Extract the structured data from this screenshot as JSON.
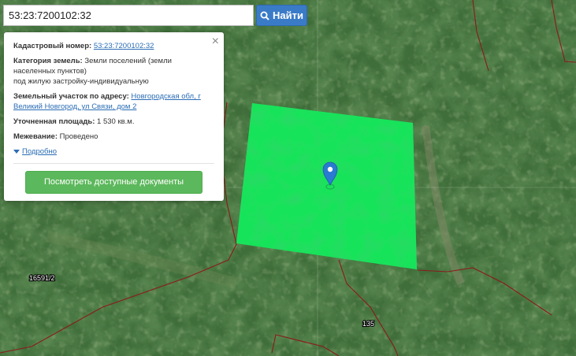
{
  "search": {
    "value": "53:23:7200102:32",
    "button_label": "Найти"
  },
  "popup": {
    "cadastral_label": "Кадастровый номер:",
    "cadastral_value": "53:23:7200102:32",
    "category_label": "Категория земель:",
    "category_value_line1": "Земли поселений (земли",
    "category_value_line2": "населенных пунктов)",
    "category_value_line3": "под жилую застройку-индивидуальную",
    "address_label": "Земельный участок по адресу:",
    "address_line1": "Новгородская обл, г",
    "address_line2": "Великий Новгород, ул Связи, дом 2",
    "area_label": "Уточненная площадь:",
    "area_value": "1 530 кв.м.",
    "survey_label": "Межевание:",
    "survey_value": "Проведено",
    "more_label": "Подробно",
    "docs_button": "Посмотреть доступные документы",
    "close_symbol": "×"
  },
  "map": {
    "parcel_labels": [
      "16591/2",
      "135"
    ],
    "colors": {
      "parcel_fill": "#19e35a",
      "boundary": "#8b1a1a",
      "marker": "#2a7ad1"
    }
  }
}
